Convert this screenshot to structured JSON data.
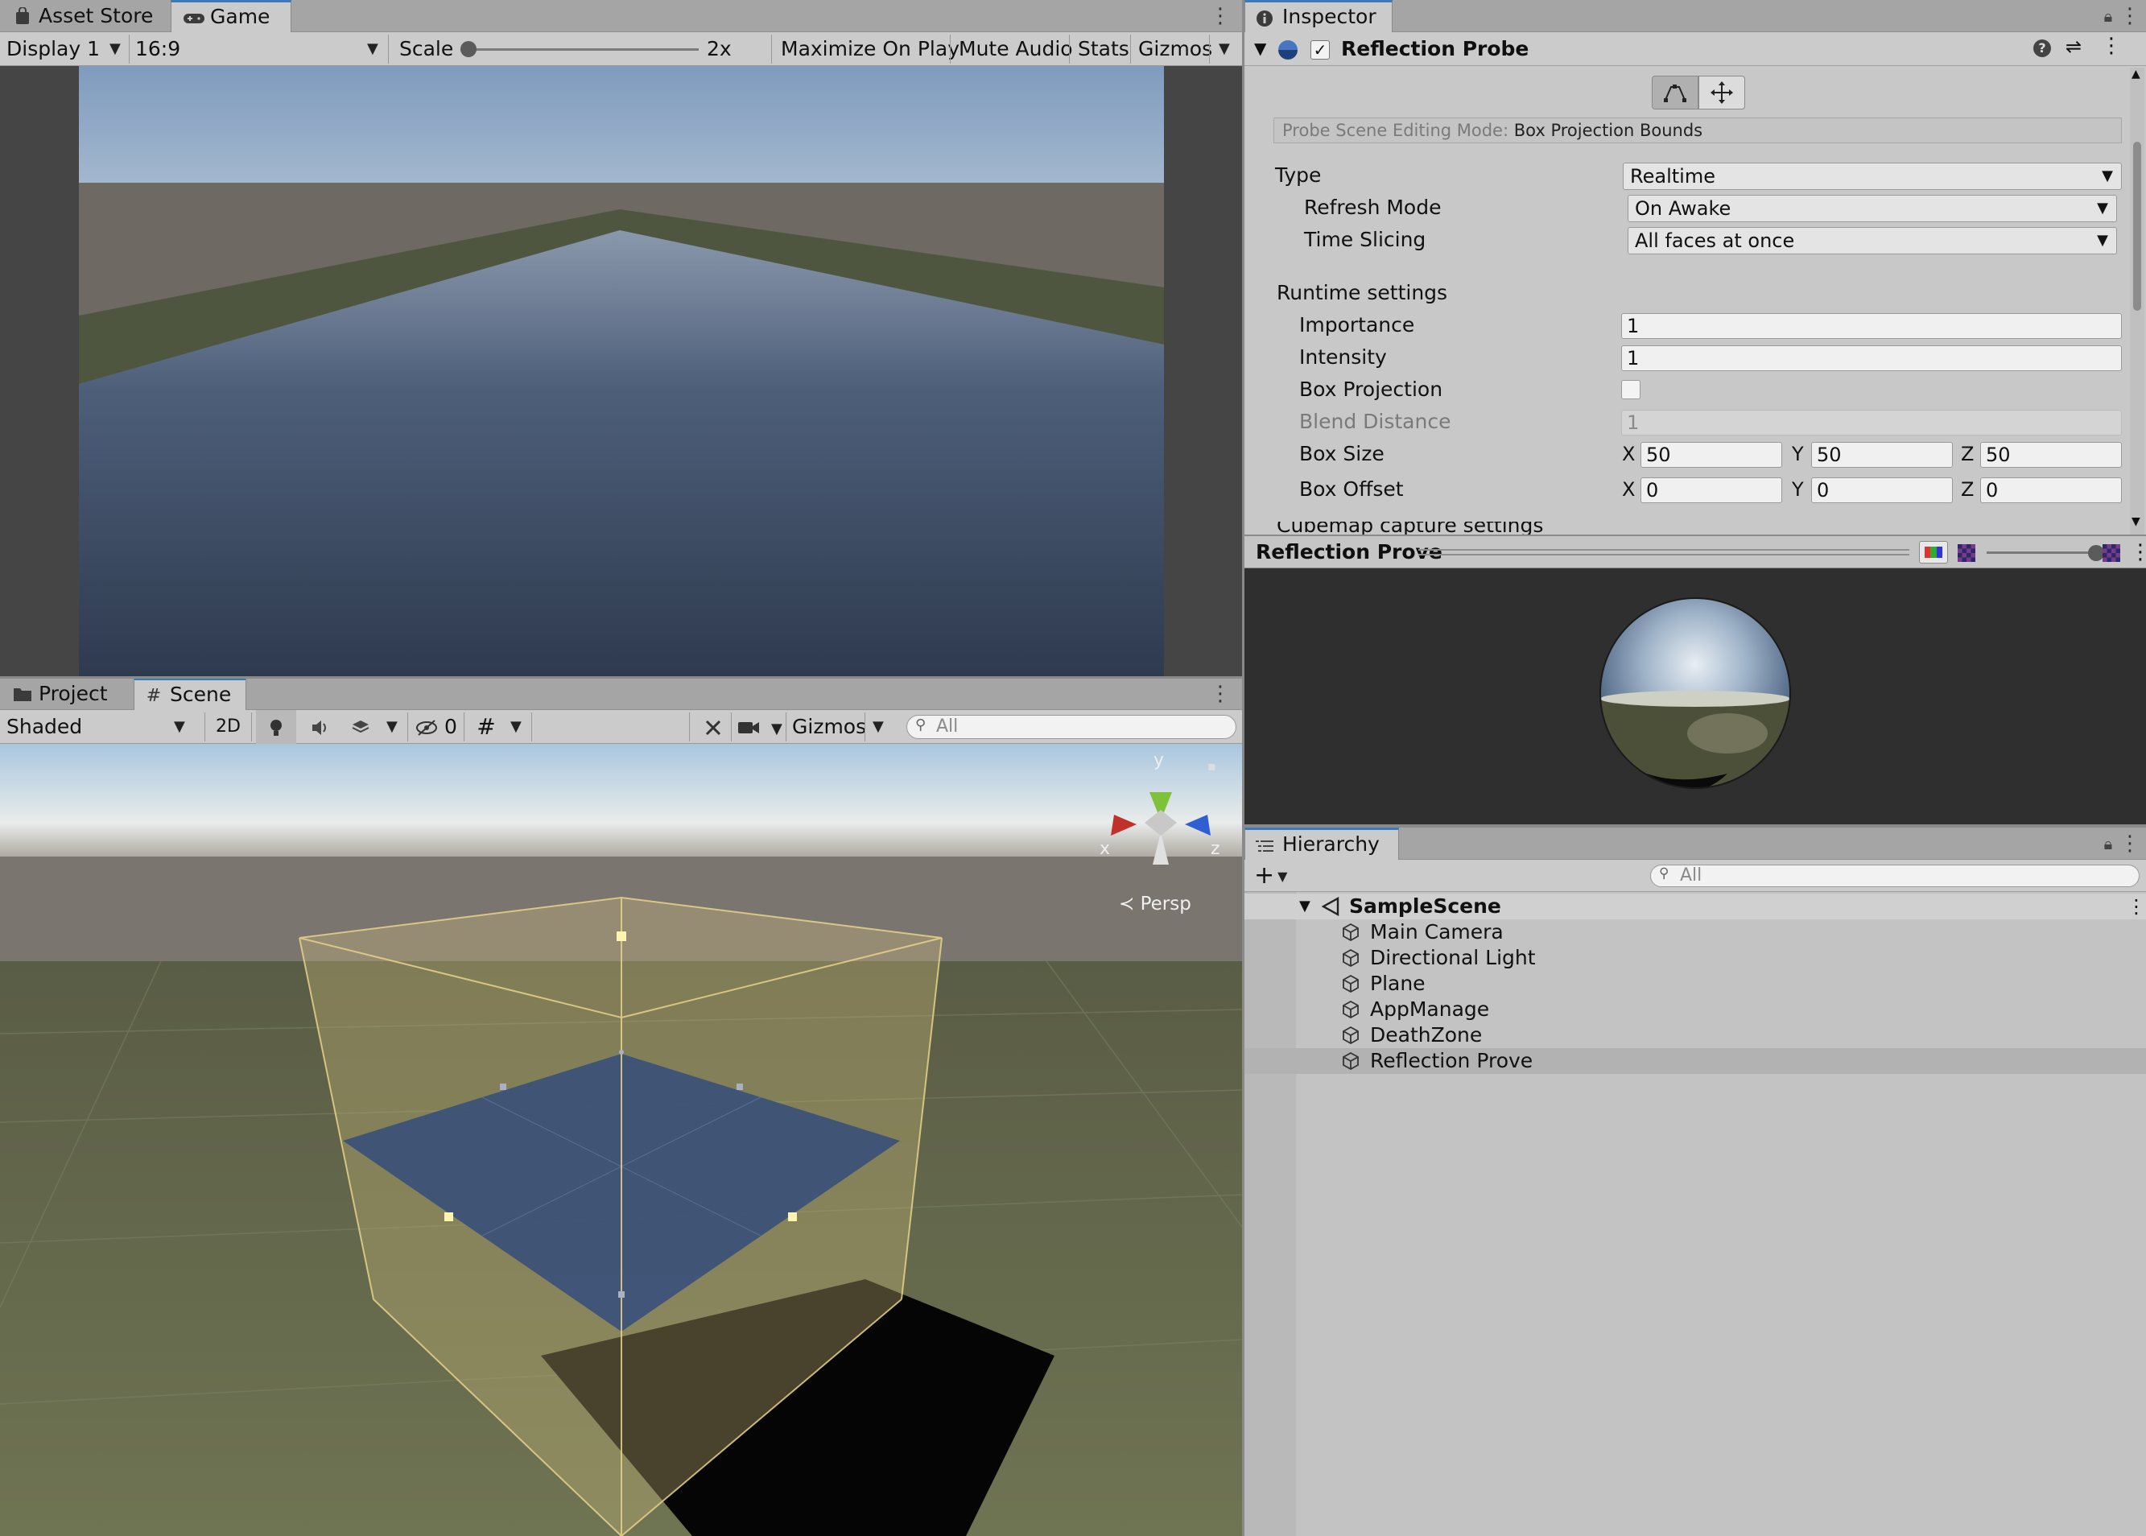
{
  "game_panel": {
    "tabs": [
      {
        "label": "Asset Store",
        "icon": "shopping-bag-icon"
      },
      {
        "label": "Game",
        "icon": "gamepad-icon"
      }
    ],
    "display": "Display 1",
    "aspect": "16:9",
    "scale_label": "Scale",
    "scale_value": "2x",
    "maximize_on_play": "Maximize On Play",
    "mute_audio": "Mute Audio",
    "stats": "Stats",
    "gizmos": "Gizmos"
  },
  "scene_panel": {
    "tabs": [
      {
        "label": "Project",
        "icon": "folder-icon"
      },
      {
        "label": "Scene",
        "icon": "grid-hash-icon"
      }
    ],
    "shading": "Shaded",
    "mode_2d": "2D",
    "hidden_count": "0",
    "gizmos": "Gizmos",
    "search_placeholder": "All",
    "gizmo_axes": {
      "y": "y",
      "x": "x",
      "z": "z"
    },
    "projection": "Persp"
  },
  "inspector": {
    "tab": "Inspector",
    "component_name": "Reflection Probe",
    "component_enabled": true,
    "editing_mode_label": "Probe Scene Editing Mode:",
    "editing_mode_value": "Box Projection Bounds",
    "type_label": "Type",
    "type_value": "Realtime",
    "refresh_mode_label": "Refresh Mode",
    "refresh_mode_value": "On Awake",
    "time_slicing_label": "Time Slicing",
    "time_slicing_value": "All faces at once",
    "runtime_settings": "Runtime settings",
    "importance_label": "Importance",
    "importance_value": "1",
    "intensity_label": "Intensity",
    "intensity_value": "1",
    "box_projection_label": "Box Projection",
    "box_projection_checked": false,
    "blend_distance_label": "Blend Distance",
    "blend_distance_value": "1",
    "box_size_label": "Box Size",
    "box_size": {
      "x": "50",
      "y": "50",
      "z": "50"
    },
    "box_offset_label": "Box Offset",
    "box_offset": {
      "x": "0",
      "y": "0",
      "z": "0"
    },
    "axis_labels": {
      "x": "X",
      "y": "Y",
      "z": "Z"
    },
    "cutoff_section": "Cubemap capture settings"
  },
  "preview": {
    "title": "Reflection Prove"
  },
  "hierarchy": {
    "tab": "Hierarchy",
    "search_placeholder": "All",
    "scene": "SampleScene",
    "items": [
      {
        "label": "Main Camera",
        "selected": false
      },
      {
        "label": "Directional Light",
        "selected": false
      },
      {
        "label": "Plane",
        "selected": false
      },
      {
        "label": "AppManage",
        "selected": false
      },
      {
        "label": "DeathZone",
        "selected": false
      },
      {
        "label": "Reflection Prove",
        "selected": true
      }
    ]
  },
  "colors": {
    "accent": "#3a79bb",
    "panel": "#c8c8c8",
    "tabbar": "#a5a5a5",
    "box_gizmo": "#e8d28a"
  }
}
